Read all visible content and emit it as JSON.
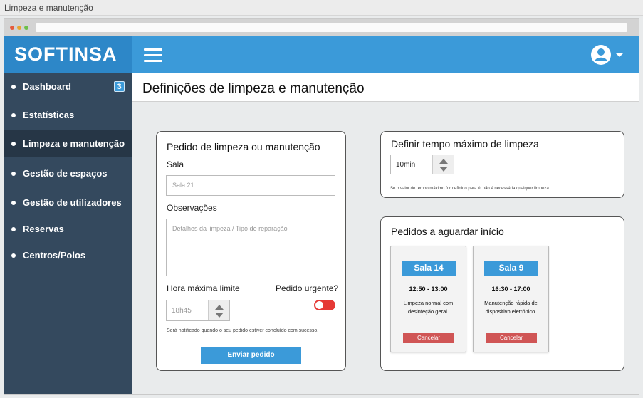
{
  "window": {
    "title": "Limpeza e manutenção"
  },
  "app": {
    "logo": "SOFTINSA",
    "menu_icon": "hamburger-icon",
    "user_icon": "user-account-icon",
    "accent": "#3b9ad9",
    "sidebar_bg": "#34495e"
  },
  "sidebar": {
    "items": [
      {
        "label": "Dashboard",
        "badge": "3"
      },
      {
        "label": "Estatísticas"
      },
      {
        "label": "Limpeza e manutenção",
        "active": true
      },
      {
        "label": "Gestão de espaços"
      },
      {
        "label": "Gestão de utilizadores"
      },
      {
        "label": "Reservas"
      },
      {
        "label": "Centros/Polos"
      }
    ]
  },
  "page": {
    "title": "Definições de limpeza e manutenção"
  },
  "request_form": {
    "title": "Pedido de limpeza ou manutenção",
    "room_label": "Sala",
    "room_placeholder": "Sala 21",
    "notes_label": "Observações",
    "notes_placeholder": "Detalhes da limpeza / Tipo de reparação",
    "time_label": "Hora máxima limite",
    "time_placeholder": "18h45",
    "urgent_label": "Pedido urgente?",
    "urgent_toggle": "off",
    "notice": "Será notificado quando o seu pedido estiver concluído com sucesso.",
    "submit_label": "Enviar pedido"
  },
  "max_time": {
    "title": "Definir tempo máximo de limpeza",
    "value": "10min",
    "notice": "Se o valor de tempo máximo for definido para 0, não é necessária qualquer limpeza."
  },
  "pending": {
    "title": "Pedidos a aguardar início",
    "requests": [
      {
        "room": "Sala 14",
        "time": "12:50 - 13:00",
        "description": "Limpeza normal com desinfeção geral.",
        "cancel_label": "Cancelar"
      },
      {
        "room": "Sala 9",
        "time": "16:30 - 17:00",
        "description": "Manutenção rápida de dispositivo eletrónico.",
        "cancel_label": "Cancelar"
      }
    ]
  }
}
